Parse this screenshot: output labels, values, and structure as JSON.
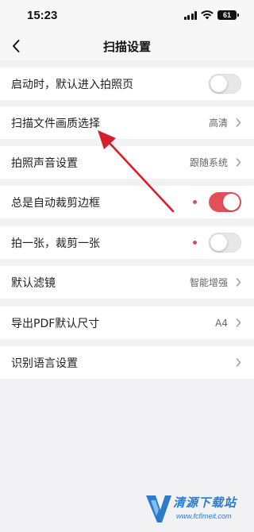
{
  "status_bar": {
    "time": "15:23",
    "battery": "61"
  },
  "nav": {
    "title": "扫描设置"
  },
  "settings": [
    {
      "label": "启动时，默认进入拍照页",
      "toggle": "off"
    },
    {
      "label": "扫描文件画质选择",
      "value": "高清"
    },
    {
      "label": "拍照声音设置",
      "value": "跟随系统"
    },
    {
      "label": "总是自动裁剪边框",
      "toggle": "on",
      "dot": true
    },
    {
      "label": "拍一张，裁剪一张",
      "toggle": "off",
      "dot": true
    },
    {
      "label": "默认滤镜",
      "value": "智能增强"
    },
    {
      "label": "导出PDF默认尺寸",
      "value": "A4"
    },
    {
      "label": "识别语言设置",
      "value": ""
    }
  ],
  "colors": {
    "accent": "#e3505c",
    "arrow": "#d81e2a",
    "watermark": "#2b7bc9"
  },
  "watermark": {
    "title": "清源下载站",
    "url": "www.fcfimeit.com"
  }
}
